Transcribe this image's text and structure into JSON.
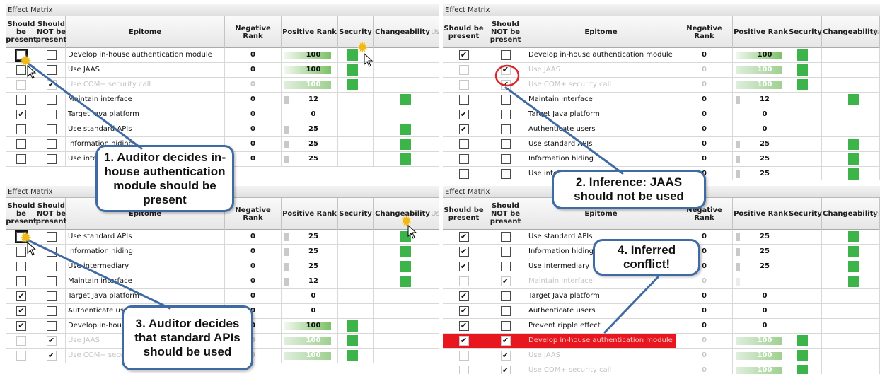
{
  "panels": [
    {
      "title": "Effect Matrix",
      "headers": {
        "present": "Should be present",
        "not_present": "Should NOT be present",
        "epitome": "Epitome",
        "neg": "Negative Rank",
        "pos": "Positive Rank",
        "security": "Security",
        "changeability": "Changeability",
        "extra": "Us"
      },
      "rows": [
        {
          "present": false,
          "not_present": false,
          "label": "Develop in-house authentication module",
          "neg": "0",
          "pos": "100",
          "pos_fill": 1.0,
          "security": true,
          "changeability": false,
          "disabled": false
        },
        {
          "present": false,
          "not_present": false,
          "label": "Use JAAS",
          "neg": "0",
          "pos": "100",
          "pos_fill": 1.0,
          "security": true,
          "changeability": false,
          "disabled": false
        },
        {
          "present": false,
          "not_present": true,
          "label": "Use COM+ security call",
          "neg": "0",
          "pos": "100",
          "pos_fill": 1.0,
          "security": true,
          "changeability": false,
          "disabled": true
        },
        {
          "present": false,
          "not_present": false,
          "label": "Maintain interface",
          "neg": "0",
          "pos": "12",
          "pos_fill": 0.12,
          "security": false,
          "changeability": true,
          "disabled": false
        },
        {
          "present": true,
          "not_present": false,
          "label": "Target Java platform",
          "neg": "0",
          "pos": "0",
          "pos_fill": 0,
          "security": false,
          "changeability": false,
          "disabled": false
        },
        {
          "present": false,
          "not_present": false,
          "label": "Use standard APIs",
          "neg": "0",
          "pos": "25",
          "pos_fill": 0.25,
          "security": false,
          "changeability": true,
          "disabled": false
        },
        {
          "present": false,
          "not_present": false,
          "label": "Information hiding",
          "neg": "0",
          "pos": "25",
          "pos_fill": 0.25,
          "security": false,
          "changeability": true,
          "disabled": false
        },
        {
          "present": false,
          "not_present": false,
          "label": "Use intermediary",
          "neg": "0",
          "pos": "25",
          "pos_fill": 0.25,
          "security": false,
          "changeability": true,
          "disabled": false
        }
      ]
    },
    {
      "title": "Effect Matrix",
      "headers": {
        "present": "Should be present",
        "not_present": "Should NOT be present",
        "epitome": "Epitome",
        "neg": "Negative Rank",
        "pos": "Positive Rank",
        "security": "Security",
        "changeability": "Changeability",
        "extra": "User"
      },
      "rows": [
        {
          "present": true,
          "not_present": false,
          "label": "Develop in-house authentication module",
          "neg": "0",
          "pos": "100",
          "pos_fill": 1.0,
          "security": true,
          "changeability": false,
          "disabled": false
        },
        {
          "present": false,
          "not_present": true,
          "label": "Use JAAS",
          "neg": "0",
          "pos": "100",
          "pos_fill": 1.0,
          "security": true,
          "changeability": false,
          "disabled": true
        },
        {
          "present": false,
          "not_present": true,
          "label": "Use COM+ security call",
          "neg": "0",
          "pos": "100",
          "pos_fill": 1.0,
          "security": true,
          "changeability": false,
          "disabled": true
        },
        {
          "present": false,
          "not_present": false,
          "label": "Maintain interface",
          "neg": "0",
          "pos": "12",
          "pos_fill": 0.12,
          "security": false,
          "changeability": true,
          "disabled": false
        },
        {
          "present": true,
          "not_present": false,
          "label": "Target Java platform",
          "neg": "0",
          "pos": "0",
          "pos_fill": 0,
          "security": false,
          "changeability": false,
          "disabled": false
        },
        {
          "present": true,
          "not_present": false,
          "label": "Authenticate users",
          "neg": "0",
          "pos": "0",
          "pos_fill": 0,
          "security": false,
          "changeability": false,
          "disabled": false
        },
        {
          "present": false,
          "not_present": false,
          "label": "Use standard APIs",
          "neg": "0",
          "pos": "25",
          "pos_fill": 0.25,
          "security": false,
          "changeability": true,
          "disabled": false
        },
        {
          "present": false,
          "not_present": false,
          "label": "Information hiding",
          "neg": "0",
          "pos": "25",
          "pos_fill": 0.25,
          "security": false,
          "changeability": true,
          "disabled": false
        },
        {
          "present": false,
          "not_present": false,
          "label": "Use intermediary",
          "neg": "0",
          "pos": "25",
          "pos_fill": 0.25,
          "security": false,
          "changeability": true,
          "disabled": false
        }
      ]
    },
    {
      "title": "Effect Matrix",
      "headers": {
        "present": "Should be present",
        "not_present": "Should NOT be present",
        "epitome": "Epitome",
        "neg": "Negative Rank",
        "pos": "Positive Rank",
        "security": "Security",
        "changeability": "Changeability",
        "extra": "Us"
      },
      "rows": [
        {
          "present": false,
          "not_present": false,
          "label": "Use standard APIs",
          "neg": "0",
          "pos": "25",
          "pos_fill": 0.25,
          "security": false,
          "changeability": true,
          "disabled": false
        },
        {
          "present": false,
          "not_present": false,
          "label": "Information hiding",
          "neg": "0",
          "pos": "25",
          "pos_fill": 0.25,
          "security": false,
          "changeability": true,
          "disabled": false
        },
        {
          "present": false,
          "not_present": false,
          "label": "Use intermediary",
          "neg": "0",
          "pos": "25",
          "pos_fill": 0.25,
          "security": false,
          "changeability": true,
          "disabled": false
        },
        {
          "present": false,
          "not_present": false,
          "label": "Maintain interface",
          "neg": "0",
          "pos": "12",
          "pos_fill": 0.12,
          "security": false,
          "changeability": true,
          "disabled": false
        },
        {
          "present": true,
          "not_present": false,
          "label": "Target Java platform",
          "neg": "0",
          "pos": "0",
          "pos_fill": 0,
          "security": false,
          "changeability": false,
          "disabled": false
        },
        {
          "present": true,
          "not_present": false,
          "label": "Authenticate users",
          "neg": "0",
          "pos": "0",
          "pos_fill": 0,
          "security": false,
          "changeability": false,
          "disabled": false
        },
        {
          "present": true,
          "not_present": false,
          "label": "Develop in-house authentication module",
          "neg": "0",
          "pos": "100",
          "pos_fill": 1.0,
          "security": true,
          "changeability": false,
          "disabled": false
        },
        {
          "present": false,
          "not_present": true,
          "label": "Use JAAS",
          "neg": "0",
          "pos": "100",
          "pos_fill": 1.0,
          "security": true,
          "changeability": false,
          "disabled": true
        },
        {
          "present": false,
          "not_present": true,
          "label": "Use COM+ security call",
          "neg": "0",
          "pos": "100",
          "pos_fill": 1.0,
          "security": true,
          "changeability": false,
          "disabled": true
        }
      ]
    },
    {
      "title": "Effect Matrix",
      "headers": {
        "present": "Should be present",
        "not_present": "Should NOT be present",
        "epitome": "Epitome",
        "neg": "Negative Rank",
        "pos": "Positive Rank",
        "security": "Security",
        "changeability": "Changeability",
        "extra": "Use"
      },
      "rows": [
        {
          "present": true,
          "not_present": false,
          "label": "Use standard APIs",
          "neg": "0",
          "pos": "25",
          "pos_fill": 0.25,
          "security": false,
          "changeability": true,
          "disabled": false
        },
        {
          "present": true,
          "not_present": false,
          "label": "Information hiding",
          "neg": "0",
          "pos": "25",
          "pos_fill": 0.25,
          "security": false,
          "changeability": true,
          "disabled": false
        },
        {
          "present": true,
          "not_present": false,
          "label": "Use intermediary",
          "neg": "0",
          "pos": "25",
          "pos_fill": 0.25,
          "security": false,
          "changeability": true,
          "disabled": false
        },
        {
          "present": false,
          "not_present": true,
          "label": "Maintain interface",
          "neg": "0",
          "pos": "12",
          "pos_fill": 0.12,
          "security": false,
          "changeability": true,
          "disabled": true
        },
        {
          "present": true,
          "not_present": false,
          "label": "Target Java platform",
          "neg": "0",
          "pos": "0",
          "pos_fill": 0,
          "security": false,
          "changeability": false,
          "disabled": false
        },
        {
          "present": true,
          "not_present": false,
          "label": "Authenticate users",
          "neg": "0",
          "pos": "0",
          "pos_fill": 0,
          "security": false,
          "changeability": false,
          "disabled": false
        },
        {
          "present": true,
          "not_present": false,
          "label": "Prevent ripple effect",
          "neg": "0",
          "pos": "0",
          "pos_fill": 0,
          "security": false,
          "changeability": false,
          "disabled": false
        },
        {
          "present": true,
          "not_present": true,
          "label": "Develop in-house authentication module",
          "neg": "0",
          "pos": "100",
          "pos_fill": 1.0,
          "security": true,
          "changeability": false,
          "disabled": true,
          "conflict": true
        },
        {
          "present": false,
          "not_present": true,
          "label": "Use JAAS",
          "neg": "0",
          "pos": "100",
          "pos_fill": 1.0,
          "security": true,
          "changeability": false,
          "disabled": true
        },
        {
          "present": false,
          "not_present": true,
          "label": "Use COM+ security call",
          "neg": "0",
          "pos": "100",
          "pos_fill": 1.0,
          "security": true,
          "changeability": false,
          "disabled": true
        }
      ]
    }
  ],
  "callouts": [
    {
      "text": "1. Auditor decides in-house authentication module should be present"
    },
    {
      "text": "2. Inference: JAAS should not be used"
    },
    {
      "text": "3. Auditor decides that standard APIs should be used"
    },
    {
      "text": "4. Inferred conflict!"
    }
  ],
  "colors": {
    "bar_green": "#3cb449",
    "conflict_red": "#e8171f",
    "callout_border": "#3f6aa4",
    "highlight_circle": "#d9262a"
  }
}
